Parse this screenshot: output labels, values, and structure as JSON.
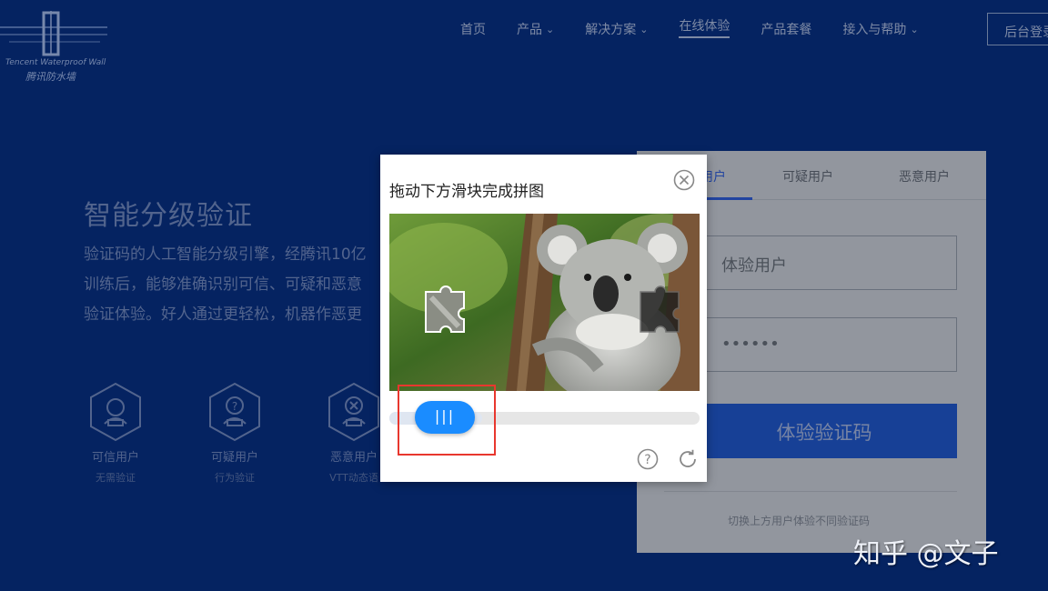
{
  "header": {
    "logo_en": "Tencent Waterproof Wall",
    "logo_cn": "腾讯防水墙",
    "nav": [
      {
        "label": "首页",
        "chevron": false
      },
      {
        "label": "产品",
        "chevron": true
      },
      {
        "label": "解决方案",
        "chevron": true
      },
      {
        "label": "在线体验",
        "chevron": false,
        "active": true
      },
      {
        "label": "产品套餐",
        "chevron": false
      },
      {
        "label": "接入与帮助",
        "chevron": true
      }
    ],
    "login_label": "后台登录"
  },
  "hero": {
    "title": "智能分级验证",
    "lines": [
      "验证码的人工智能分级引擎，经腾讯10亿",
      "训练后，能够准确识别可信、可疑和恶意",
      "验证体验。好人通过更轻松，机器作恶更"
    ]
  },
  "user_types": [
    {
      "title": "可信用户",
      "sub": "无需验证",
      "icon": "person-icon"
    },
    {
      "title": "可疑用户",
      "sub": "行为验证",
      "icon": "question-person-icon"
    },
    {
      "title": "恶意用户",
      "sub": "VTT动态语",
      "icon": "x-person-icon"
    }
  ],
  "card": {
    "tabs": [
      "体验用户",
      "可疑用户",
      "恶意用户"
    ],
    "username": "体验用户",
    "password": "••••••",
    "submit_label": "体验验证码",
    "hint": "切换上方用户体验不同验证码"
  },
  "captcha": {
    "title": "拖动下方滑块完成拼图",
    "handle_label": "|||",
    "progress": 0.12
  },
  "watermark": "知乎 @文子",
  "colors": {
    "background": "#072f82",
    "accent": "#1a8cff",
    "highlight": "#e8372e"
  }
}
